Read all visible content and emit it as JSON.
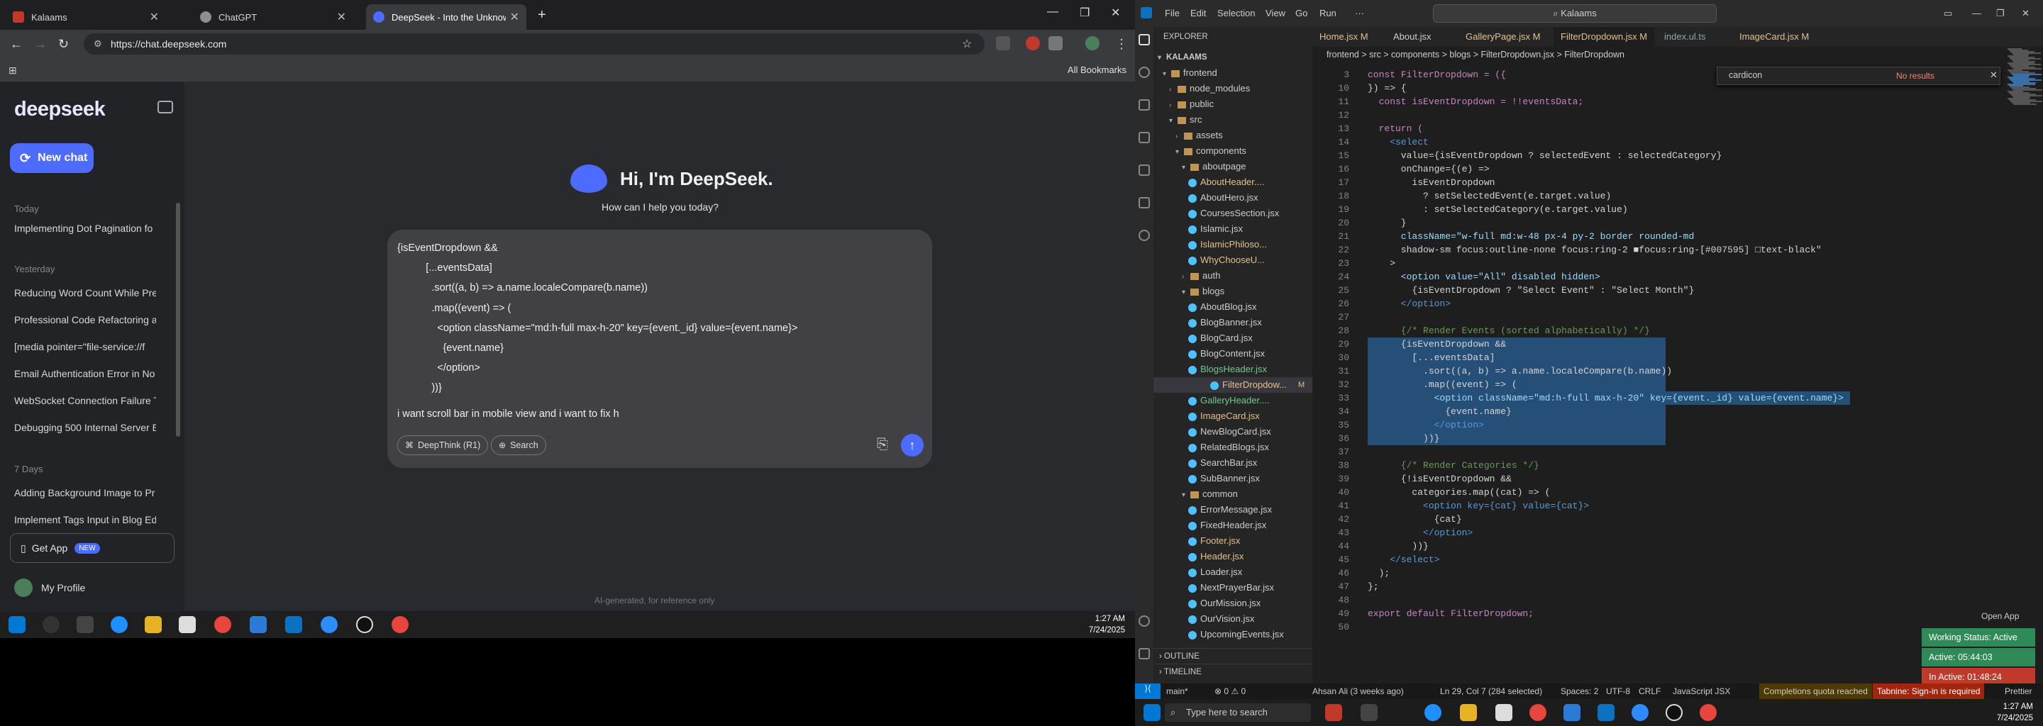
{
  "chrome": {
    "tabs": [
      {
        "title": "Kalaams",
        "color": "#c0392b"
      },
      {
        "title": "ChatGPT",
        "color": "#8e8e8e"
      },
      {
        "title": "DeepSeek - Into the Unknown",
        "color": "#4d6bfe"
      }
    ],
    "url": "https://chat.deepseek.com",
    "all_bookmarks": "All Bookmarks"
  },
  "deepseek": {
    "logo": "deepseek",
    "new_chat": "New chat",
    "groups": {
      "today": "Today",
      "yesterday": "Yesterday",
      "seven_days": "7 Days"
    },
    "history_today": [
      "Implementing Dot Pagination fo"
    ],
    "history_yesterday": [
      "Reducing Word Count While Pre",
      "Professional Code Refactoring a",
      "[media pointer=\"file-service://f",
      "Email Authentication Error in No",
      "WebSocket Connection Failure T",
      "Debugging 500 Internal Server E"
    ],
    "history_7days": [
      "Adding Background Image to Pr",
      "Implement Tags Input in Blog Ed"
    ],
    "get_app": "Get App",
    "new_badge": "NEW",
    "profile": "My Profile",
    "greeting": "Hi, I'm DeepSeek.",
    "help": "How can I help you today?",
    "composer_code": "{isEventDropdown &&\n          [...eventsData]\n            .sort((a, b) => a.name.localeCompare(b.name))\n            .map((event) => (\n              <option className=\"md:h-full max-h-20\" key={event._id} value={event.name}>\n                {event.name}\n              </option>\n            ))}",
    "typed": "i want scroll bar in mobile view and i want to fix h",
    "deepthink": "DeepThink (R1)",
    "search": "Search",
    "footer": "AI-generated, for reference only"
  },
  "taskbar1": {
    "time": "1:27 AM",
    "date": "7/24/2025"
  },
  "vscode": {
    "menus": [
      "File",
      "Edit",
      "Selection",
      "View",
      "Go",
      "Run",
      "···"
    ],
    "command_center": "Kalaams",
    "explorer_title": "EXPLORER",
    "root": "KALAAMS",
    "tree": [
      {
        "name": "frontend",
        "depth": 1,
        "kind": "folder",
        "open": true
      },
      {
        "name": "node_modules",
        "depth": 2,
        "kind": "folder",
        "open": false
      },
      {
        "name": "public",
        "depth": 2,
        "kind": "folder",
        "open": false
      },
      {
        "name": "src",
        "depth": 2,
        "kind": "folder",
        "open": true
      },
      {
        "name": "assets",
        "depth": 3,
        "kind": "folder",
        "open": false
      },
      {
        "name": "components",
        "depth": 3,
        "kind": "folder",
        "open": true
      },
      {
        "name": "aboutpage",
        "depth": 4,
        "kind": "folder",
        "open": true
      },
      {
        "name": "AboutHeader....",
        "depth": 5,
        "kind": "file",
        "git": "M"
      },
      {
        "name": "AboutHero.jsx",
        "depth": 5,
        "kind": "file"
      },
      {
        "name": "CoursesSection.jsx",
        "depth": 5,
        "kind": "file"
      },
      {
        "name": "Islamic.jsx",
        "depth": 5,
        "kind": "file"
      },
      {
        "name": "IslamicPhiloso...",
        "depth": 5,
        "kind": "file",
        "git": "M"
      },
      {
        "name": "WhyChooseU...",
        "depth": 5,
        "kind": "file",
        "git": "M"
      },
      {
        "name": "auth",
        "depth": 4,
        "kind": "folder",
        "open": false
      },
      {
        "name": "blogs",
        "depth": 4,
        "kind": "folder",
        "open": true
      },
      {
        "name": "AboutBlog.jsx",
        "depth": 5,
        "kind": "file"
      },
      {
        "name": "BlogBanner.jsx",
        "depth": 5,
        "kind": "file"
      },
      {
        "name": "BlogCard.jsx",
        "depth": 5,
        "kind": "file"
      },
      {
        "name": "BlogContent.jsx",
        "depth": 5,
        "kind": "file"
      },
      {
        "name": "BlogsHeader.jsx",
        "depth": 5,
        "kind": "file",
        "git": "U"
      },
      {
        "name": "FilterDropdow...",
        "depth": 5,
        "kind": "file",
        "git": "M",
        "selected": true
      },
      {
        "name": "GalleryHeader....",
        "depth": 5,
        "kind": "file",
        "git": "U"
      },
      {
        "name": "ImageCard.jsx",
        "depth": 5,
        "kind": "file",
        "git": "M"
      },
      {
        "name": "NewBlogCard.jsx",
        "depth": 5,
        "kind": "file"
      },
      {
        "name": "RelatedBlogs.jsx",
        "depth": 5,
        "kind": "file"
      },
      {
        "name": "SearchBar.jsx",
        "depth": 5,
        "kind": "file"
      },
      {
        "name": "SubBanner.jsx",
        "depth": 5,
        "kind": "file"
      },
      {
        "name": "common",
        "depth": 4,
        "kind": "folder",
        "open": true
      },
      {
        "name": "ErrorMessage.jsx",
        "depth": 5,
        "kind": "file"
      },
      {
        "name": "FixedHeader.jsx",
        "depth": 5,
        "kind": "file"
      },
      {
        "name": "Footer.jsx",
        "depth": 5,
        "kind": "file",
        "git": "M"
      },
      {
        "name": "Header.jsx",
        "depth": 5,
        "kind": "file",
        "git": "M"
      },
      {
        "name": "Loader.jsx",
        "depth": 5,
        "kind": "file"
      },
      {
        "name": "NextPrayerBar.jsx",
        "depth": 5,
        "kind": "file"
      },
      {
        "name": "OurMission.jsx",
        "depth": 5,
        "kind": "file"
      },
      {
        "name": "OurVision.jsx",
        "depth": 5,
        "kind": "file"
      },
      {
        "name": "UpcomingEvents.jsx",
        "depth": 5,
        "kind": "file"
      }
    ],
    "outline": "OUTLINE",
    "timeline": "TIMELINE",
    "tabs": [
      "Home.jsx M",
      "About.jsx",
      "GalleryPage.jsx M",
      "FilterDropdown.jsx M",
      "index.ul.ts",
      "ImageCard.jsx M"
    ],
    "breadcrumb": "frontend > src > components > blogs > FilterDropdown.jsx > FilterDropdown",
    "find_query": "cardicon",
    "find_result": "No results",
    "line_numbers": [
      "3",
      "10",
      "11",
      "12",
      "13",
      "14",
      "15",
      "16",
      "17",
      "18",
      "19",
      "20",
      "21",
      "22",
      "23",
      "24",
      "25",
      "26",
      "27",
      "28",
      "29",
      "30",
      "31",
      "32",
      "33",
      "34",
      "35",
      "36",
      "37",
      "38",
      "39",
      "40",
      "41",
      "42",
      "43",
      "44",
      "45",
      "46",
      "47",
      "48",
      "49",
      "50"
    ],
    "code_lines": [
      "const FilterDropdown = ({",
      "}) => {",
      "  const isEventDropdown = !!eventsData;",
      "",
      "  return (",
      "    <select",
      "      value={isEventDropdown ? selectedEvent : selectedCategory}",
      "      onChange={(e) =>",
      "        isEventDropdown",
      "          ? setSelectedEvent(e.target.value)",
      "          : setSelectedCategory(e.target.value)",
      "      }",
      "      className=\"w-full md:w-48 px-4 py-2 border rounded-md",
      "      shadow-sm focus:outline-none focus:ring-2 ■focus:ring-[#007595] □text-black\"",
      "    >",
      "      <option value=\"All\" disabled hidden>",
      "        {isEventDropdown ? \"Select Event\" : \"Select Month\"}",
      "      </option>",
      "",
      "      {/* Render Events (sorted alphabetically) */}",
      "      {isEventDropdown &&",
      "        [...eventsData]",
      "          .sort((a, b) => a.name.localeCompare(b.name))",
      "          .map((event) => (",
      "            <option className=\"md:h-full max-h-20\" key={event._id} value={event.name}>",
      "              {event.name}",
      "            </option>",
      "          ))}",
      "",
      "      {/* Render Categories */}",
      "      {!isEventDropdown &&",
      "        categories.map((cat) => (",
      "          <option key={cat} value={cat}>",
      "            {cat}",
      "          </option>",
      "        ))}",
      "    </select>",
      "  );",
      "};",
      "",
      "export default FilterDropdown;",
      ""
    ],
    "status": {
      "branch": "main*",
      "problems": "⊗ 0 ⚠ 0",
      "blame": "Ahsan Ali (3 weeks ago)",
      "position": "Ln 29, Col 7 (284 selected)",
      "spaces": "Spaces: 2",
      "encoding": "UTF-8",
      "eol": "CRLF",
      "language": "JavaScript JSX",
      "quota": "Completions quota reached",
      "tabnine": "Tabnine: Sign-in is required",
      "prettier": "Prettier"
    },
    "open_app": "Open App",
    "work_status": "Working Status: Active",
    "active_time": "Active: 05:44:03",
    "inactive_time": "In Active: 01:48:24"
  },
  "taskbar2": {
    "search": "Type here to search",
    "time": "1:27 AM",
    "date": "7/24/2025"
  }
}
